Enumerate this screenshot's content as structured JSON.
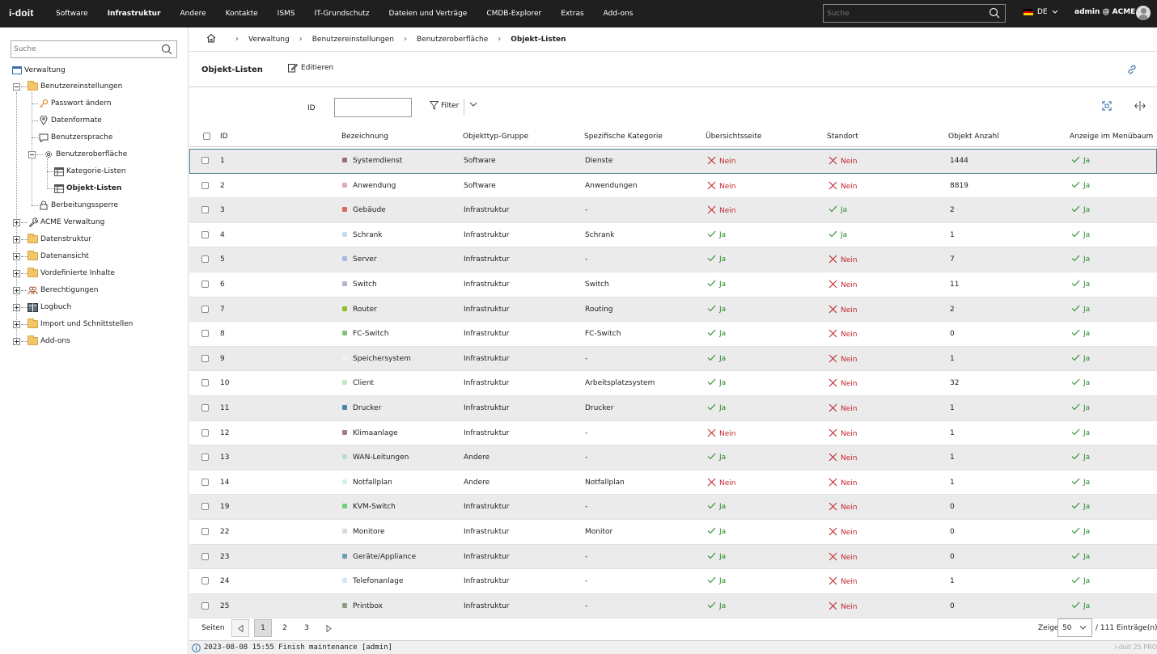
{
  "header": {
    "logo": "i-doit",
    "nav": [
      "Software",
      "Infrastruktur",
      "Andere",
      "Kontakte",
      "ISMS",
      "IT-Grundschutz",
      "Dateien und Verträge",
      "CMDB-Explorer",
      "Extras",
      "Add-ons"
    ],
    "active_nav": "Infrastruktur",
    "search_placeholder": "Suche",
    "language": "DE",
    "user": "admin @ ACME"
  },
  "sidebar": {
    "search_placeholder": "Suche",
    "root": "Verwaltung",
    "items": {
      "benutzereinstellungen": "Benutzereinstellungen",
      "passwort": "Passwort ändern",
      "datenformate": "Datenformate",
      "benutzersprache": "Benutzersprache",
      "benutzeroberflaeche": "Benutzeroberfläche",
      "kategorie_listen": "Kategorie-Listen",
      "objekt_listen": "Objekt-Listen",
      "bearbeitungssperre": "Berbeitungssperre",
      "acme": "ACME Verwaltung",
      "datenstruktur": "Datenstruktur",
      "datenansicht": "Datenansicht",
      "vordefiniert": "Vordefinierte Inhalte",
      "berechtigungen": "Berechtigungen",
      "logbuch": "Logbuch",
      "import": "Import und Schnittstellen",
      "addons": "Add-ons"
    }
  },
  "breadcrumb": [
    "Verwaltung",
    "Benutzereinstellungen",
    "Benutzeroberfläche",
    "Objekt-Listen"
  ],
  "page": {
    "title": "Objekt-Listen",
    "edit_label": "Editieren",
    "id_label": "ID",
    "filter_label": "Filter"
  },
  "table": {
    "columns": [
      "ID",
      "Bezeichnung",
      "Objekttyp-Gruppe",
      "Spezifische Kategorie",
      "Übersichtsseite",
      "Standort",
      "Objekt Anzahl",
      "Anzeige im Menübaum"
    ],
    "rows": [
      {
        "id": "1",
        "name": "Systemdienst",
        "color": "#9a6b78",
        "group": "Software",
        "cat": "Dienste",
        "overview": "Nein",
        "location": "Nein",
        "count": "1444",
        "menu": "Ja"
      },
      {
        "id": "2",
        "name": "Anwendung",
        "color": "#e2a9c6",
        "group": "Software",
        "cat": "Anwendungen",
        "overview": "Nein",
        "location": "Nein",
        "count": "8819",
        "menu": "Ja"
      },
      {
        "id": "3",
        "name": "Gebäude",
        "color": "#d9685a",
        "group": "Infrastruktur",
        "cat": "-",
        "overview": "Nein",
        "location": "Ja",
        "count": "2",
        "menu": "Ja"
      },
      {
        "id": "4",
        "name": "Schrank",
        "color": "#c9dcef",
        "group": "Infrastruktur",
        "cat": "Schrank",
        "overview": "Ja",
        "location": "Ja",
        "count": "1",
        "menu": "Ja"
      },
      {
        "id": "5",
        "name": "Server",
        "color": "#a9b8e6",
        "group": "Infrastruktur",
        "cat": "-",
        "overview": "Ja",
        "location": "Nein",
        "count": "7",
        "menu": "Ja"
      },
      {
        "id": "6",
        "name": "Switch",
        "color": "#b9b4c6",
        "group": "Infrastruktur",
        "cat": "Switch",
        "overview": "Ja",
        "location": "Nein",
        "count": "11",
        "menu": "Ja"
      },
      {
        "id": "7",
        "name": "Router",
        "color": "#8fbf2d",
        "group": "Infrastruktur",
        "cat": "Routing",
        "overview": "Ja",
        "location": "Nein",
        "count": "2",
        "menu": "Ja"
      },
      {
        "id": "8",
        "name": "FC-Switch",
        "color": "#88c07a",
        "group": "Infrastruktur",
        "cat": "FC-Switch",
        "overview": "Ja",
        "location": "Nein",
        "count": "0",
        "menu": "Ja"
      },
      {
        "id": "9",
        "name": "Speichersystem",
        "color": "#f2f2ea",
        "group": "Infrastruktur",
        "cat": "-",
        "overview": "Ja",
        "location": "Nein",
        "count": "1",
        "menu": "Ja"
      },
      {
        "id": "10",
        "name": "Client",
        "color": "#c6e6c9",
        "group": "Infrastruktur",
        "cat": "Arbeitsplatzsystem",
        "overview": "Ja",
        "location": "Nein",
        "count": "32",
        "menu": "Ja"
      },
      {
        "id": "11",
        "name": "Drucker",
        "color": "#4a84a8",
        "group": "Infrastruktur",
        "cat": "Drucker",
        "overview": "Ja",
        "location": "Nein",
        "count": "1",
        "menu": "Ja"
      },
      {
        "id": "12",
        "name": "Klimaanlage",
        "color": "#9c7c96",
        "group": "Infrastruktur",
        "cat": "-",
        "overview": "Nein",
        "location": "Nein",
        "count": "1",
        "menu": "Ja"
      },
      {
        "id": "13",
        "name": "WAN-Leitungen",
        "color": "#bcdcc5",
        "group": "Andere",
        "cat": "-",
        "overview": "Ja",
        "location": "Nein",
        "count": "1",
        "menu": "Ja"
      },
      {
        "id": "14",
        "name": "Notfallplan",
        "color": "#d6efe8",
        "group": "Andere",
        "cat": "Notfallplan",
        "overview": "Nein",
        "location": "Nein",
        "count": "1",
        "menu": "Ja"
      },
      {
        "id": "19",
        "name": "KVM-Switch",
        "color": "#6fd07a",
        "group": "Infrastruktur",
        "cat": "-",
        "overview": "Ja",
        "location": "Nein",
        "count": "0",
        "menu": "Ja"
      },
      {
        "id": "22",
        "name": "Monitore",
        "color": "#d9d9d9",
        "group": "Infrastruktur",
        "cat": "Monitor",
        "overview": "Ja",
        "location": "Nein",
        "count": "0",
        "menu": "Ja"
      },
      {
        "id": "23",
        "name": "Geräte/Appliance",
        "color": "#6a9fb0",
        "group": "Infrastruktur",
        "cat": "-",
        "overview": "Ja",
        "location": "Nein",
        "count": "0",
        "menu": "Ja"
      },
      {
        "id": "24",
        "name": "Telefonanlage",
        "color": "#d4e6f2",
        "group": "Infrastruktur",
        "cat": "-",
        "overview": "Ja",
        "location": "Nein",
        "count": "1",
        "menu": "Ja"
      },
      {
        "id": "25",
        "name": "Printbox",
        "color": "#8c9f86",
        "group": "Infrastruktur",
        "cat": "-",
        "overview": "Ja",
        "location": "Nein",
        "count": "0",
        "menu": "Ja"
      }
    ]
  },
  "pager": {
    "label": "Seiten",
    "pages": [
      "1",
      "2",
      "3"
    ],
    "current_page": "1",
    "show_label": "Zeige",
    "per_page": "50",
    "total": "/ 111 Einträge(n)"
  },
  "status": {
    "message": "2023-08-08 15:55 Finish maintenance [admin]",
    "version": "i-doit 25 PRO"
  },
  "colors": {
    "topbar": "#1f1f1f",
    "nein": "#c0262d",
    "ja": "#2b8a2b",
    "alt_row": "#ebebeb",
    "selected_outline": "#4a7b8c"
  }
}
